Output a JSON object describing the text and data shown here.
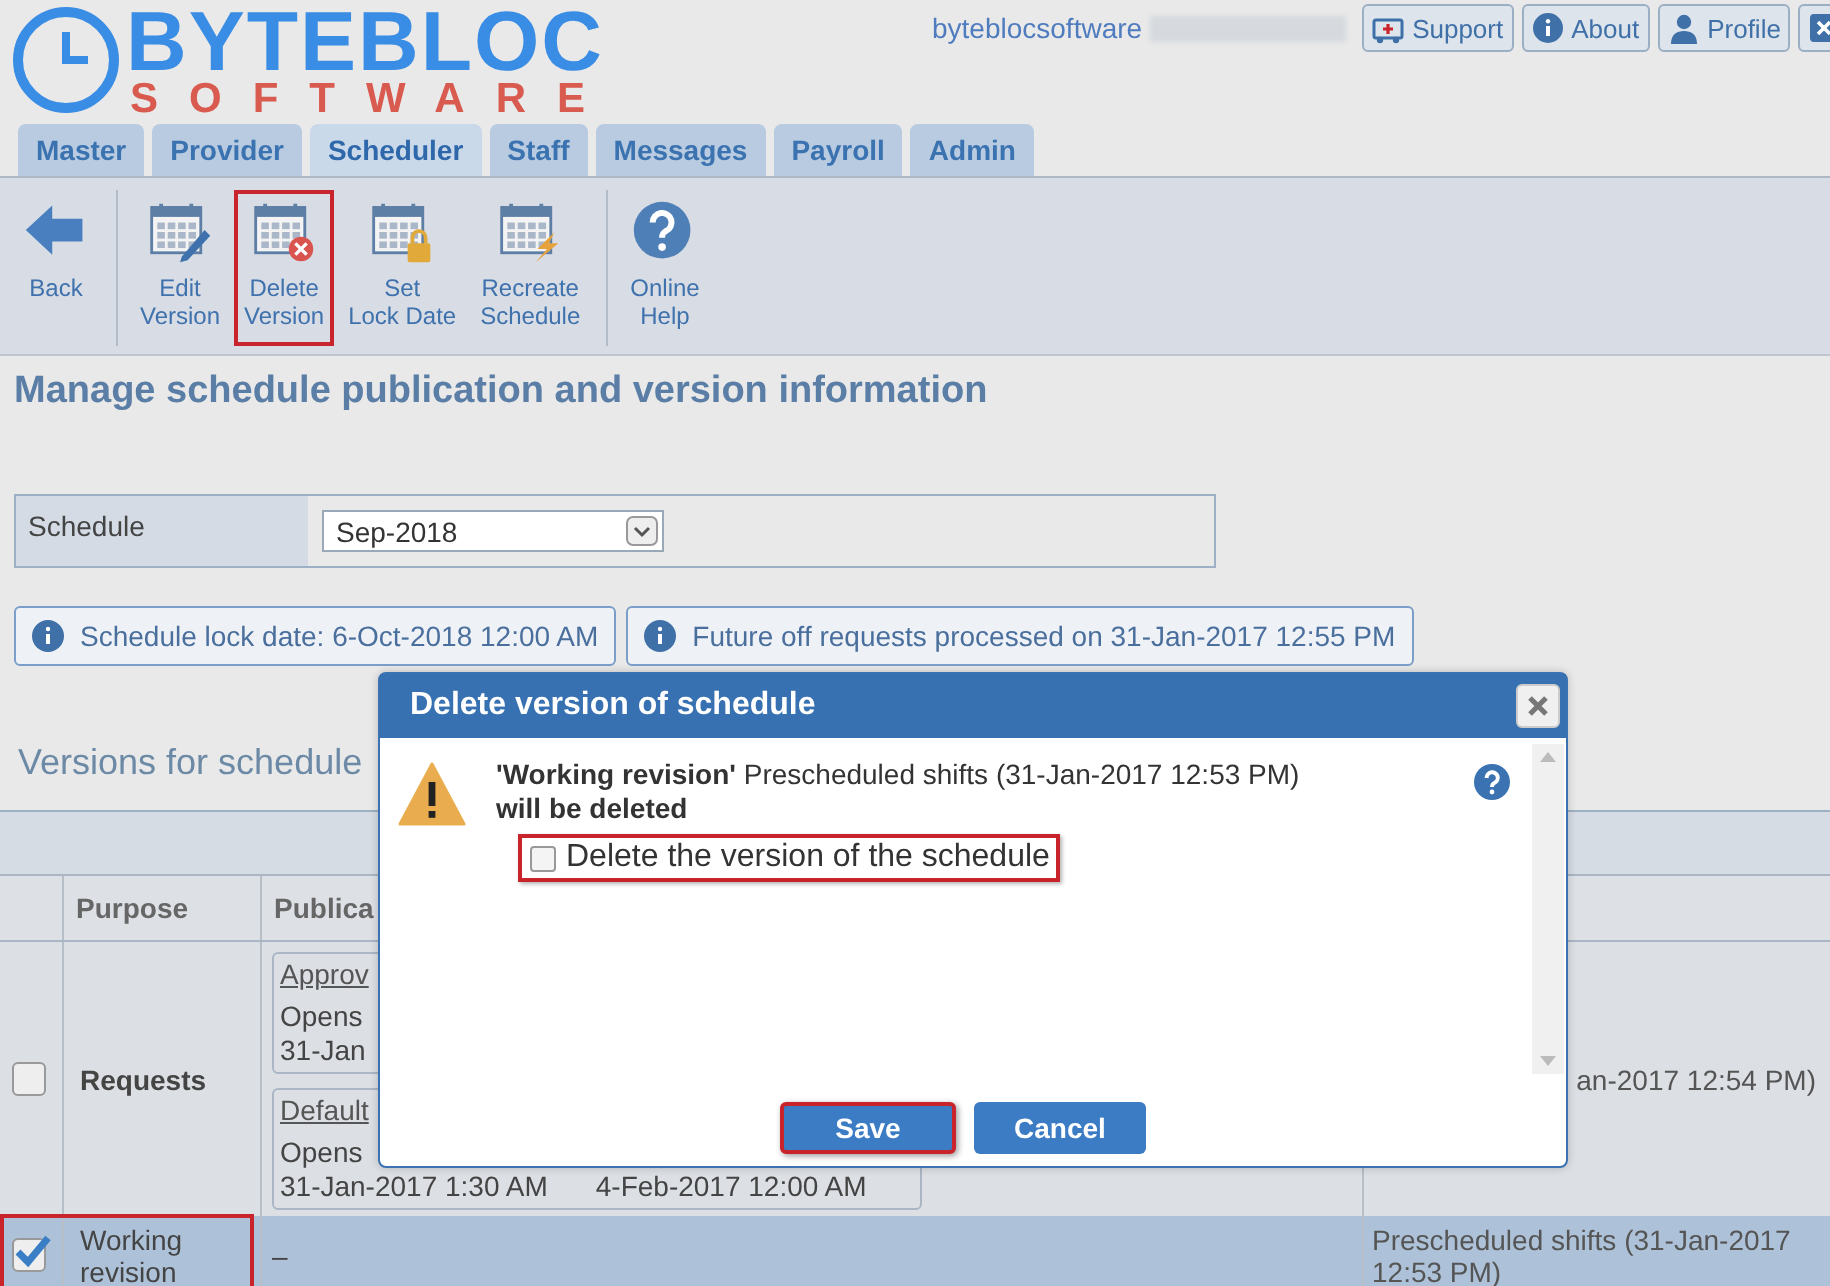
{
  "header": {
    "logo_title": "BYTEBLOC",
    "logo_subtitle": "SOFTWARE",
    "user": "byteblocsoftware",
    "buttons": [
      {
        "label": "Support",
        "kind": "support"
      },
      {
        "label": "About",
        "kind": "about"
      },
      {
        "label": "Profile",
        "kind": "profile"
      },
      {
        "kind": "logout"
      }
    ]
  },
  "tabs": [
    {
      "label": "Master",
      "selected": false
    },
    {
      "label": "Provider",
      "selected": false
    },
    {
      "label": "Scheduler",
      "selected": true
    },
    {
      "label": "Staff",
      "selected": false
    },
    {
      "label": "Messages",
      "selected": false
    },
    {
      "label": "Payroll",
      "selected": false
    },
    {
      "label": "Admin",
      "selected": false
    }
  ],
  "toolbar": [
    {
      "kind": "back",
      "lines": [
        "Back"
      ],
      "highlighted": false
    },
    {
      "kind": "edit",
      "lines": [
        "Edit",
        "Version"
      ],
      "highlighted": false
    },
    {
      "kind": "delete",
      "lines": [
        "Delete",
        "Version"
      ],
      "highlighted": true
    },
    {
      "kind": "lock",
      "lines": [
        "Set",
        "Lock Date"
      ],
      "highlighted": false
    },
    {
      "kind": "recreate",
      "lines": [
        "Recreate",
        "Schedule"
      ],
      "highlighted": false
    },
    {
      "kind": "help",
      "lines": [
        "Online",
        "Help"
      ],
      "highlighted": false
    }
  ],
  "page_title": "Manage schedule publication and version information",
  "schedule_field": {
    "label": "Schedule",
    "value": "Sep-2018"
  },
  "info_notes": [
    "Schedule lock date: 6-Oct-2018 12:00 AM",
    "Future off requests processed on 31-Jan-2017 12:55 PM"
  ],
  "versions_heading": "Versions for schedule",
  "table": {
    "columns": [
      "Purpose",
      "Publica"
    ],
    "rows": [
      {
        "checked": false,
        "selected": false,
        "highlighted": false,
        "purpose": "Requests",
        "publications": [
          {
            "title": "Approv",
            "lines": [
              "Opens",
              "31-Jan"
            ]
          },
          {
            "title": "Default",
            "lines": [
              "Opens"
            ],
            "dates": [
              "31-Jan-2017 1:30 AM",
              "4-Feb-2017 12:00 AM"
            ]
          }
        ],
        "column_3": "an-2017 12:54 PM)"
      },
      {
        "checked": true,
        "selected": true,
        "highlighted": true,
        "purpose": "Working revision",
        "publication": "–",
        "column_3": "Prescheduled shifts (31-Jan-2017 12:53 PM)"
      }
    ]
  },
  "dialog": {
    "title": "Delete version of schedule",
    "message": "**'Working revision'** Prescheduled shifts (31-Jan-2017 12:53 PM) **will be deleted**",
    "checkbox": {
      "label": "Delete the version of the schedule",
      "checked": false,
      "highlighted": true
    },
    "buttons": [
      {
        "label": "Save",
        "highlighted": true
      },
      {
        "label": "Cancel",
        "highlighted": false
      }
    ]
  }
}
